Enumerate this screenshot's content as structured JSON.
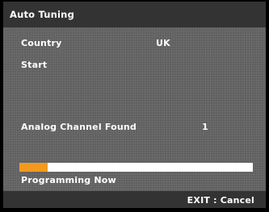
{
  "window": {
    "title": "Auto Tuning"
  },
  "settings": {
    "country_label": "Country",
    "country_value": "UK",
    "start_label": "Start"
  },
  "results": {
    "analog_found_label": "Analog Channel Found",
    "analog_found_count": "1"
  },
  "progress": {
    "fraction": 0.12,
    "fill_color": "#f39a1e",
    "status_text": "Programming Now"
  },
  "footer": {
    "exit_hint": "EXIT : Cancel"
  }
}
